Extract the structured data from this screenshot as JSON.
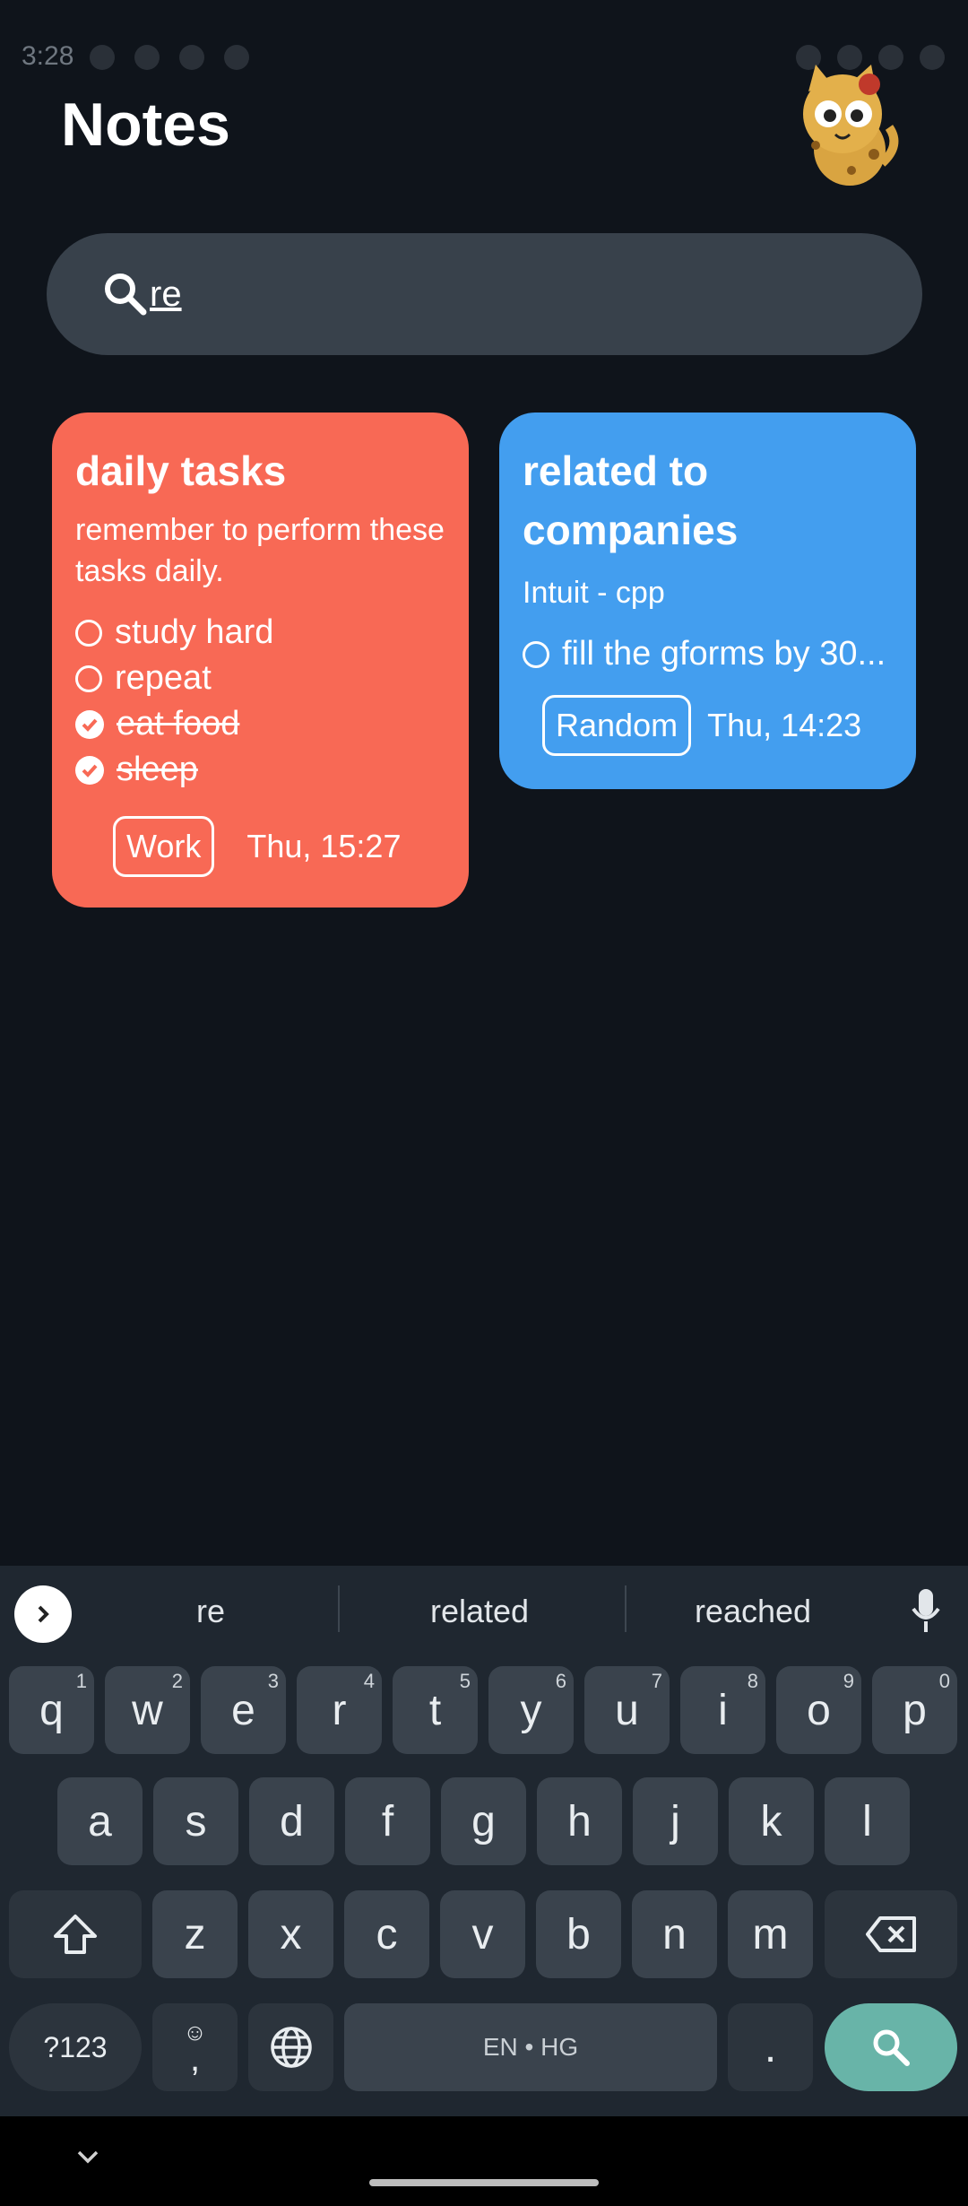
{
  "status": {
    "time": "3:28"
  },
  "header": {
    "title": "Notes"
  },
  "search": {
    "value": "re"
  },
  "notes": [
    {
      "title": "daily tasks",
      "description": "remember to perform these tasks daily.",
      "color": "#f86955",
      "checklist": [
        {
          "label": "study hard",
          "done": false
        },
        {
          "label": "repeat",
          "done": false
        },
        {
          "label": "eat food",
          "done": true
        },
        {
          "label": "sleep",
          "done": true
        }
      ],
      "tag": "Work",
      "date": "Thu, 15:27"
    },
    {
      "title": "related to companies",
      "description": "Intuit - cpp",
      "color": "#439eef",
      "checklist": [
        {
          "label": "fill the gforms by 30...",
          "done": false
        }
      ],
      "tag": "Random",
      "date": "Thu, 14:23"
    }
  ],
  "keyboard": {
    "suggestions": [
      "re",
      "related",
      "reached"
    ],
    "row1": [
      {
        "key": "q",
        "hint": "1"
      },
      {
        "key": "w",
        "hint": "2"
      },
      {
        "key": "e",
        "hint": "3"
      },
      {
        "key": "r",
        "hint": "4"
      },
      {
        "key": "t",
        "hint": "5"
      },
      {
        "key": "y",
        "hint": "6"
      },
      {
        "key": "u",
        "hint": "7"
      },
      {
        "key": "i",
        "hint": "8"
      },
      {
        "key": "o",
        "hint": "9"
      },
      {
        "key": "p",
        "hint": "0"
      }
    ],
    "row2": [
      "a",
      "s",
      "d",
      "f",
      "g",
      "h",
      "j",
      "k",
      "l"
    ],
    "row3": [
      "z",
      "x",
      "c",
      "v",
      "b",
      "n",
      "m"
    ],
    "symbols_label": "?123",
    "emoji_comma_label": ",",
    "space_label": "EN • HG",
    "period_label": "."
  },
  "icons": {
    "search": "search-icon",
    "mic": "mic-icon",
    "shift": "shift-icon",
    "backspace": "backspace-icon",
    "globe": "globe-icon",
    "emoji": "emoji-icon",
    "chevron": "chevron-right-icon"
  },
  "colors": {
    "background": "#0f141b",
    "search_bar": "#38414b",
    "keyboard": "#1f2730",
    "key": "#3a434d",
    "enter_key": "#68b4a8"
  }
}
